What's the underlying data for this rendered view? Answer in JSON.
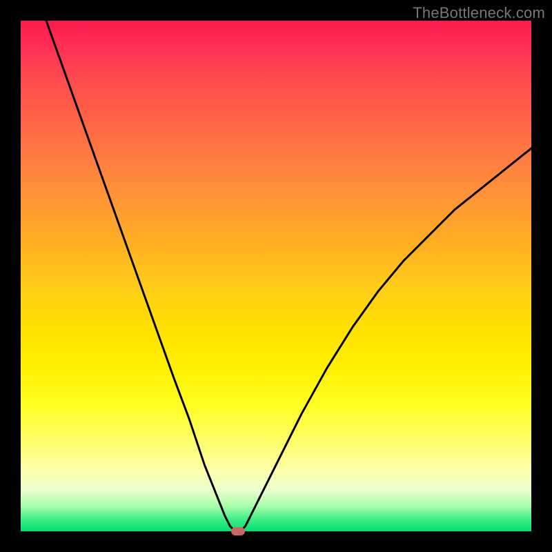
{
  "watermark": "TheBottleneck.com",
  "chart_data": {
    "type": "line",
    "title": "",
    "xlabel": "",
    "ylabel": "",
    "xlim": [
      0,
      100
    ],
    "ylim": [
      0,
      100
    ],
    "grid": false,
    "series": [
      {
        "name": "bottleneck-curve",
        "x": [
          5,
          10,
          15,
          20,
          25,
          30,
          33,
          36,
          38,
          40,
          41,
          42,
          42.5,
          43,
          44,
          45,
          47,
          50,
          55,
          60,
          65,
          70,
          75,
          80,
          85,
          90,
          95,
          100
        ],
        "y": [
          100,
          86,
          72,
          58,
          44,
          30,
          22,
          13,
          8,
          3,
          1,
          0,
          0,
          0,
          1,
          3,
          7,
          13,
          23,
          32,
          40,
          47,
          53,
          58,
          63,
          67,
          71,
          75
        ]
      }
    ],
    "marker": {
      "x": 42.5,
      "y": 0,
      "color": "#cc6666"
    },
    "background_gradient": {
      "top": "#ff1a4d",
      "middle": "#ffe000",
      "bottom": "#00e070"
    }
  }
}
